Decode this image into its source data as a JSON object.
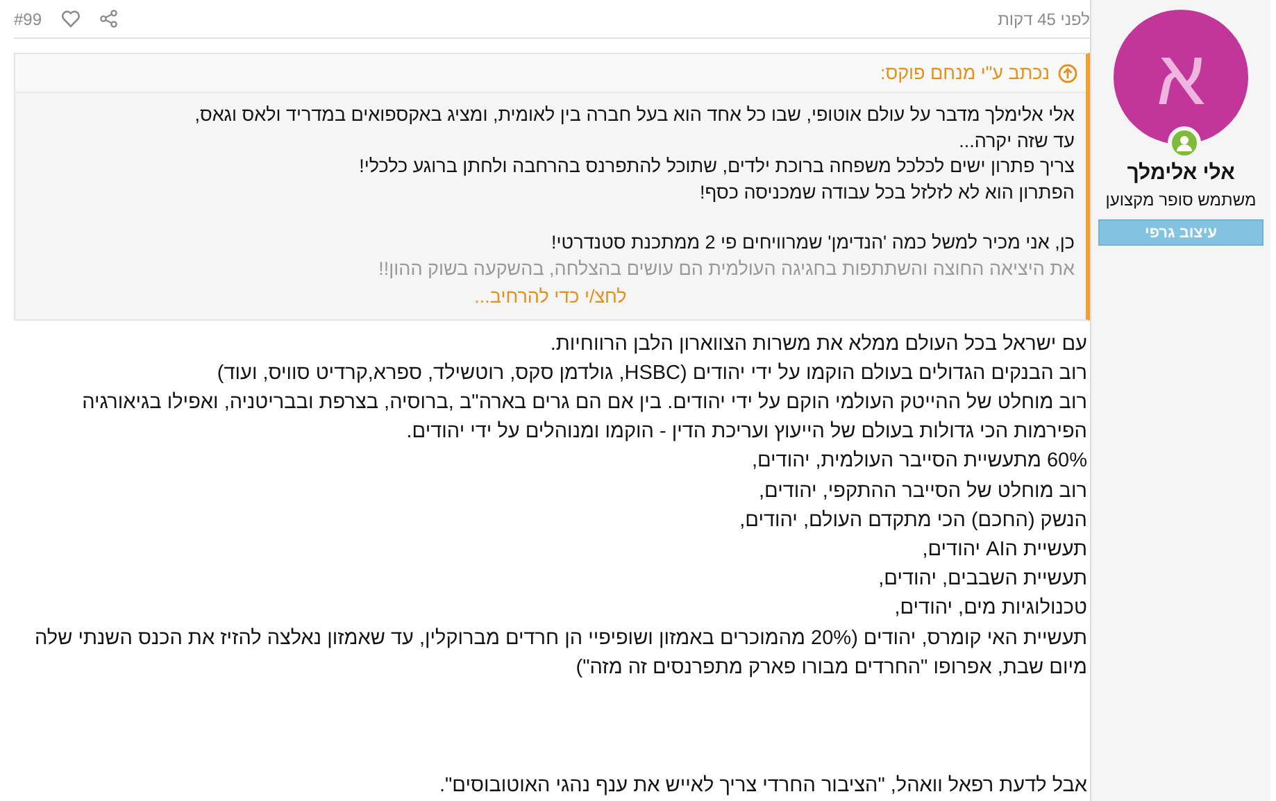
{
  "author": {
    "initial": "א",
    "name": "אלי אלימלך",
    "title": "משתמש סופר מקצוען",
    "online": true,
    "badge": "עיצוב גרפי"
  },
  "post": {
    "time": "לפני 45 דקות",
    "number": "#99"
  },
  "quote": {
    "header": "נכתב ע\"י מנחם פוקס:",
    "expand": "לחצ/י כדי להרחיב...",
    "paragraphs": [
      {
        "lines": [
          {
            "kind": "normal",
            "text": "אלי אלימלך מדבר על עולם אוטופי, שבו כל אחד הוא בעל חברה בין לאומית, ומציג באקספואים במדריד ולאס וגאס,"
          },
          {
            "kind": "normal",
            "text": "עד שזה יקרה..."
          },
          {
            "kind": "normal",
            "text": "צריך פתרון ישים לכלכל משפחה ברוכת ילדים, שתוכל להתפרנס בהרחבה ולחתן ברוגע כלכלי!"
          },
          {
            "kind": "normal",
            "text": "הפתרון הוא לא לזלזל בכל עבודה שמכניסה כסף!"
          }
        ]
      },
      {
        "lines": [
          {
            "kind": "normal",
            "text": "כן, אני מכיר למשל כמה 'הנדימן' שמרוויחים פי 2 ממתכנת סטנדרטי!"
          },
          {
            "kind": "faded",
            "text": "את היציאה החוצה והשתתפות בחגיגה העולמית הם עושים בהצלחה, בהשקעה בשוק ההון!!"
          }
        ]
      }
    ]
  },
  "body": {
    "paragraphs": [
      {
        "lines": [
          "עם ישראל בכל העולם ממלא את משרות הצווארון הלבן הרווחיות.",
          "רוב הבנקים הגדולים בעולם הוקמו על ידי יהודים (HSBC, גולדמן סקס, רוטשילד, ספרא,קרדיט סוויס, ועוד)",
          "רוב מוחלט של ההייטק העולמי הוקם על ידי יהודים. בין אם הם גרים בארה\"ב ,ברוסיה, בצרפת ובבריטניה, ואפילו בגיאורגיה הפירמות הכי גדולות בעולם של הייעוץ ועריכת הדין - הוקמו ומנוהלים על ידי יהודים.",
          "60% מתעשיית הסייבר העולמית, יהודים,",
          "רוב מוחלט של הסייבר ההתקפי, יהודים,",
          "הנשק (החכם) הכי מתקדם העולם, יהודים,",
          "תעשיית הAI יהודים,",
          "תעשיית השבבים, יהודים,",
          "טכנולוגיות מים, יהודים,",
          "תעשיית האי קומרס, יהודים (20% מהמוכרים באמזון ושופיפיי הן חרדים מברוקלין, עד שאמזון נאלצה להזיז את הכנס השנתי שלה מיום שבת, אפרופו \"החרדים מבורו פארק מתפרנסים זה מזה\")"
        ]
      },
      {
        "lines": [
          "אבל לדעת רפאל וואהל, \"הציבור החרדי צריך לאייש את ענף נהגי האוטובוסים\"."
        ]
      }
    ]
  }
}
